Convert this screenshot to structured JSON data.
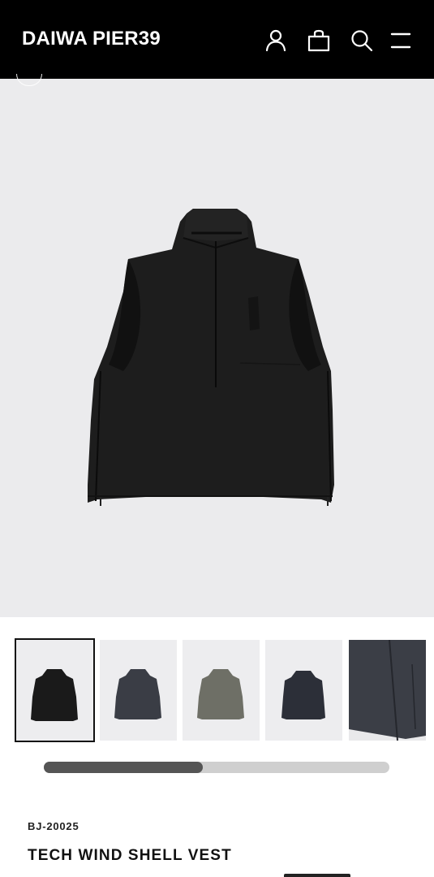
{
  "header": {
    "logo": "DAIWA PIER39",
    "icons": [
      "account-icon",
      "cart-icon",
      "search-icon",
      "menu-icon"
    ],
    "background": "#000000"
  },
  "hero": {
    "background": "#ebebed",
    "product_image": "black-vest"
  },
  "thumbnails": [
    {
      "name": "black-vest",
      "color": "#1a1a1a",
      "active": true
    },
    {
      "name": "charcoal-vest",
      "color": "#3a3d45",
      "active": false
    },
    {
      "name": "olive-vest",
      "color": "#6e6f66",
      "active": false
    },
    {
      "name": "navy-vest",
      "color": "#2c2f38",
      "active": false
    },
    {
      "name": "detail-closeup",
      "color": "#3b3e46",
      "active": false
    }
  ],
  "gallery_scroll": {
    "progress": 0.46
  },
  "product": {
    "sku": "BJ-20025",
    "title": "TECH WIND SHELL VEST"
  }
}
